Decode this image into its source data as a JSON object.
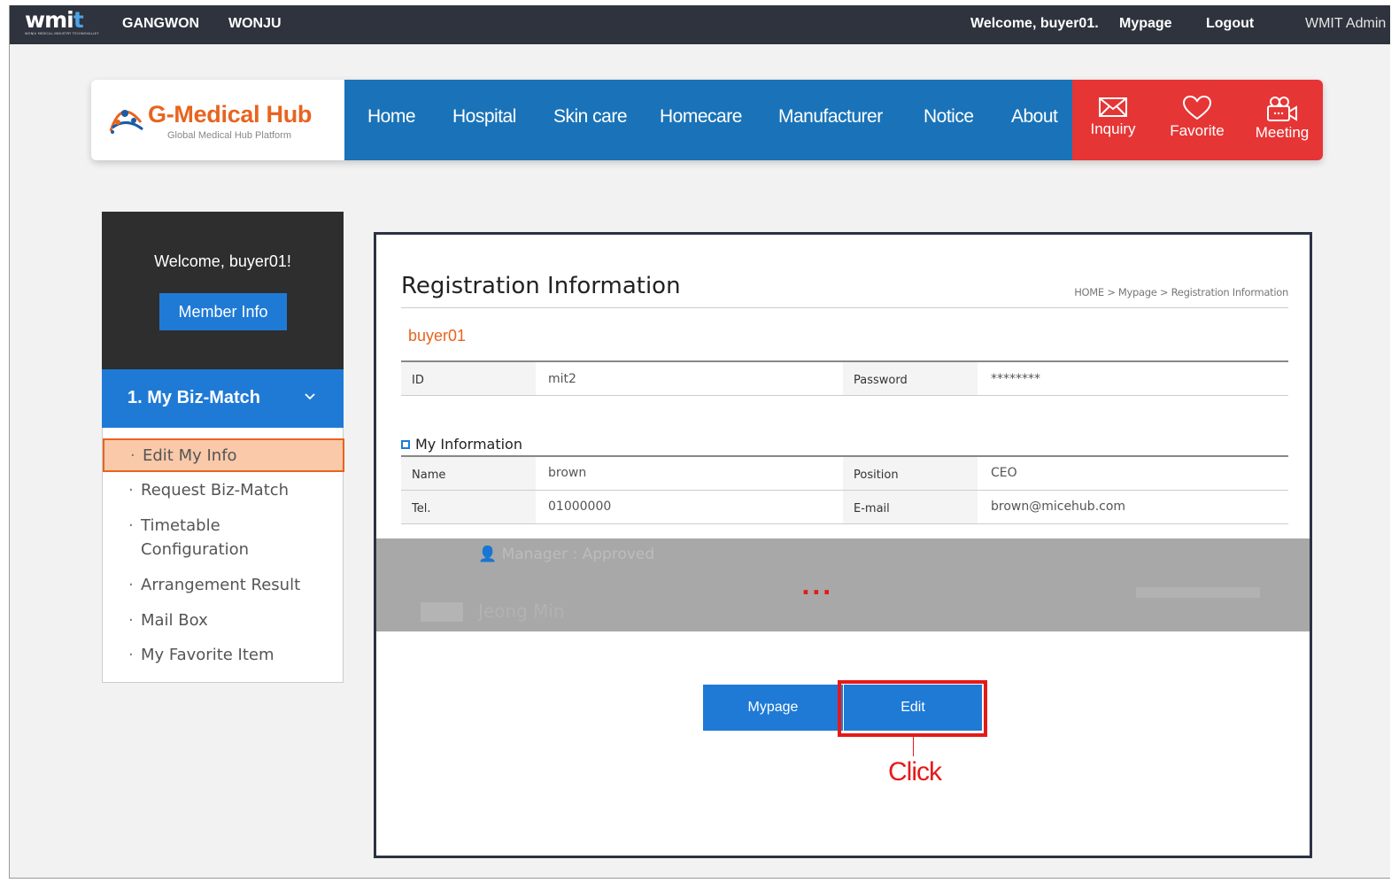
{
  "topbar": {
    "logo_text": "wmit",
    "logo_tagline": "WONJU MEDICAL INDUSTRY TECHNOVALLEY",
    "regions": [
      "GANGWON",
      "WONJU"
    ],
    "welcome": "Welcome, buyer01.",
    "mypage": "Mypage",
    "logout": "Logout",
    "admin": "WMIT Admin"
  },
  "header": {
    "brand_name": "G-Medical Hub",
    "brand_sub": "Global Medical Hub Platform",
    "nav": [
      "Home",
      "Hospital",
      "Skin care",
      "Homecare",
      "Manufacturer",
      "Notice",
      "About"
    ],
    "actions": [
      {
        "label": "Inquiry",
        "icon": "envelope-icon"
      },
      {
        "label": "Favorite",
        "icon": "heart-icon"
      },
      {
        "label": "Meeting",
        "icon": "video-camera-icon"
      }
    ],
    "nav_color": "#1a73b8",
    "action_color": "#e63535",
    "brand_color": "#e8641f"
  },
  "sidebar": {
    "welcome": "Welcome, buyer01!",
    "member_info": "Member Info",
    "category": "1. My Biz-Match",
    "items": [
      {
        "label": "Edit My Info",
        "active": true
      },
      {
        "label": "Request Biz-Match",
        "active": false
      },
      {
        "label": "Timetable Configuration",
        "active": false
      },
      {
        "label": "Arrangement Result",
        "active": false
      },
      {
        "label": "Mail Box",
        "active": false
      },
      {
        "label": "My Favorite Item",
        "active": false
      }
    ],
    "bullet": "·"
  },
  "content": {
    "title": "Registration Information",
    "breadcrumb": "HOME > Mypage > Registration Information",
    "username": "buyer01",
    "account": {
      "id_label": "ID",
      "id_value": "mit2",
      "password_label": "Password",
      "password_value": "********"
    },
    "my_info_heading": "My Information",
    "my_info": {
      "name_label": "Name",
      "name_value": "brown",
      "position_label": "Position",
      "position_value": "CEO",
      "tel_label": "Tel.",
      "tel_value": "01000000",
      "email_label": "E-mail",
      "email_value": "brown@micehub.com"
    },
    "ellipsis": "...",
    "faded_section": "Manager : Approved",
    "faded_name": "Jeong Min",
    "buttons": {
      "mypage": "Mypage",
      "edit": "Edit"
    },
    "callout": "Click"
  }
}
